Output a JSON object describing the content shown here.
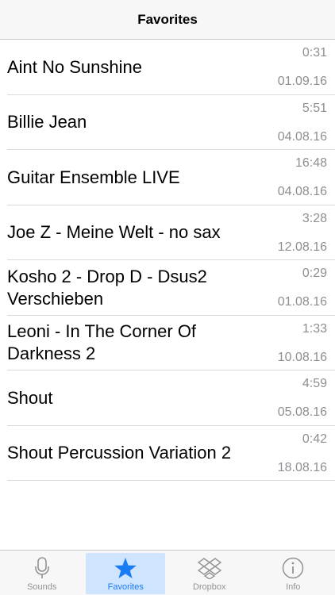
{
  "navbar": {
    "title": "Favorites"
  },
  "favorites": [
    {
      "title": "Aint No Sunshine",
      "duration": "0:31",
      "date": "01.09.16"
    },
    {
      "title": "Billie Jean",
      "duration": "5:51",
      "date": "04.08.16"
    },
    {
      "title": "Guitar Ensemble LIVE",
      "duration": "16:48",
      "date": "04.08.16"
    },
    {
      "title": "Joe Z - Meine Welt - no sax",
      "duration": "3:28",
      "date": "12.08.16"
    },
    {
      "title": "Kosho 2 - Drop D - Dsus2 Verschieben",
      "duration": "0:29",
      "date": "01.08.16"
    },
    {
      "title": "Leoni - In The Corner Of Darkness 2",
      "duration": "1:33",
      "date": "10.08.16"
    },
    {
      "title": "Shout",
      "duration": "4:59",
      "date": "05.08.16"
    },
    {
      "title": "Shout Percussion Variation 2",
      "duration": "0:42",
      "date": "18.08.16"
    }
  ],
  "tabbar": {
    "tabs": [
      {
        "label": "Sounds",
        "icon": "microphone-icon"
      },
      {
        "label": "Favorites",
        "icon": "star-icon"
      },
      {
        "label": "Dropbox",
        "icon": "dropbox-icon"
      },
      {
        "label": "Info",
        "icon": "info-icon"
      }
    ],
    "active_index": 1,
    "active_color": "#1a7cf5",
    "inactive_color": "#929292"
  }
}
